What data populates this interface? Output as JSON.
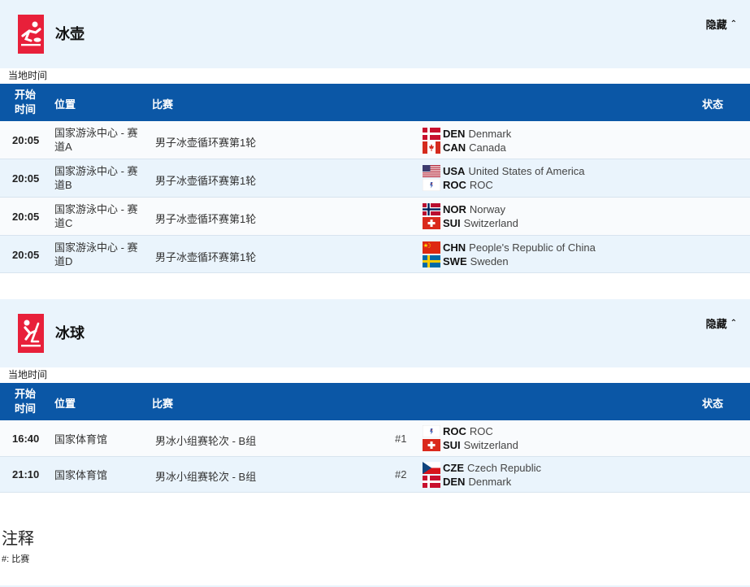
{
  "sections": [
    {
      "title": "冰壶",
      "icon": "curling-pictogram-icon",
      "hide_label": "隐藏",
      "local_time_label": "当地时间",
      "headers": {
        "start_l1": "开始",
        "start_l2": "时间",
        "location": "位置",
        "event": "比赛",
        "status": "状态"
      },
      "rows": [
        {
          "time": "20:05",
          "location": "国家游泳中心 - 赛道A",
          "event": "男子冰壶循环赛第1轮",
          "match_no": "",
          "teams": [
            {
              "code": "DEN",
              "name": "Denmark",
              "flag": "denmark-flag-icon"
            },
            {
              "code": "CAN",
              "name": "Canada",
              "flag": "canada-flag-icon"
            }
          ]
        },
        {
          "time": "20:05",
          "location": "国家游泳中心 - 赛道B",
          "event": "男子冰壶循环赛第1轮",
          "match_no": "",
          "teams": [
            {
              "code": "USA",
              "name": "United States of America",
              "flag": "usa-flag-icon"
            },
            {
              "code": "ROC",
              "name": "ROC",
              "flag": "roc-flag-icon"
            }
          ]
        },
        {
          "time": "20:05",
          "location": "国家游泳中心 - 赛道C",
          "event": "男子冰壶循环赛第1轮",
          "match_no": "",
          "teams": [
            {
              "code": "NOR",
              "name": "Norway",
              "flag": "norway-flag-icon"
            },
            {
              "code": "SUI",
              "name": "Switzerland",
              "flag": "switzerland-flag-icon"
            }
          ]
        },
        {
          "time": "20:05",
          "location": "国家游泳中心 - 赛道D",
          "event": "男子冰壶循环赛第1轮",
          "match_no": "",
          "teams": [
            {
              "code": "CHN",
              "name": "People's Republic of China",
              "flag": "china-flag-icon"
            },
            {
              "code": "SWE",
              "name": "Sweden",
              "flag": "sweden-flag-icon"
            }
          ]
        }
      ]
    },
    {
      "title": "冰球",
      "icon": "ice-hockey-pictogram-icon",
      "hide_label": "隐藏",
      "local_time_label": "当地时间",
      "headers": {
        "start_l1": "开始",
        "start_l2": "时间",
        "location": "位置",
        "event": "比赛",
        "status": "状态"
      },
      "rows": [
        {
          "time": "16:40",
          "location": "国家体育馆",
          "event": "男冰小组赛轮次 - B组",
          "match_no": "#1",
          "teams": [
            {
              "code": "ROC",
              "name": "ROC",
              "flag": "roc-flag-icon"
            },
            {
              "code": "SUI",
              "name": "Switzerland",
              "flag": "switzerland-flag-icon"
            }
          ]
        },
        {
          "time": "21:10",
          "location": "国家体育馆",
          "event": "男冰小组赛轮次 - B组",
          "match_no": "#2",
          "teams": [
            {
              "code": "CZE",
              "name": "Czech Republic",
              "flag": "czech-flag-icon"
            },
            {
              "code": "DEN",
              "name": "Denmark",
              "flag": "denmark-flag-icon"
            }
          ]
        }
      ]
    }
  ],
  "notes": {
    "title": "注释",
    "text": "#: 比赛"
  },
  "colors": {
    "header_blue": "#0b57a6",
    "light_blue": "#eaf4fc",
    "pictogram_red": "#e8203a"
  }
}
